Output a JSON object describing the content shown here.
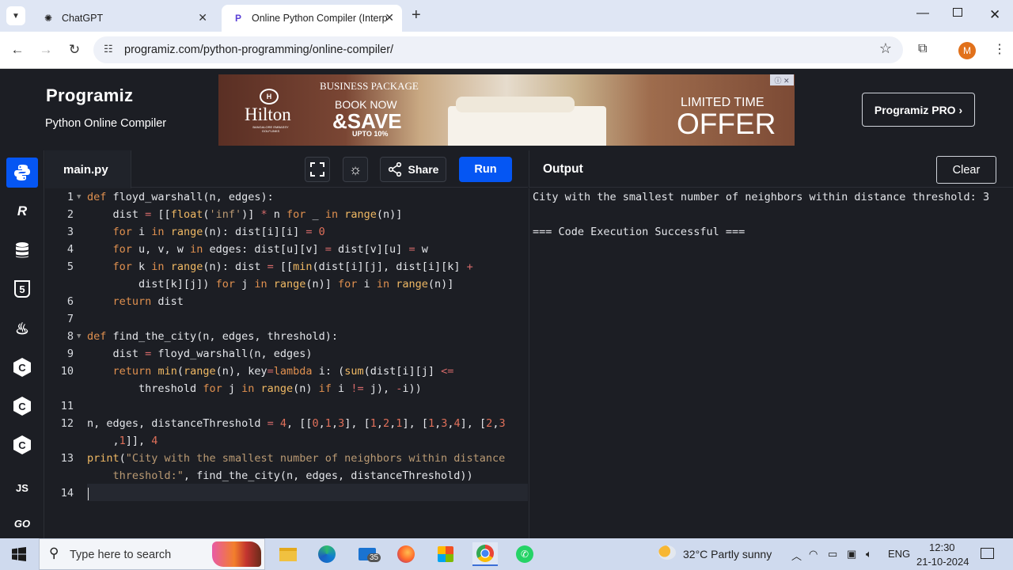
{
  "browser": {
    "tabs": [
      {
        "title": "ChatGPT",
        "active": false
      },
      {
        "title": "Online Python Compiler (Interp",
        "active": true
      }
    ],
    "url": "programiz.com/python-programming/online-compiler/",
    "profile_initial": "M"
  },
  "site": {
    "logo": "Programiz",
    "subtitle": "Python Online Compiler",
    "pro_button": "Programiz PRO ›",
    "ad": {
      "brand": "Hilton",
      "brand_sub": "BANGALORE EMBASSY GOLFLINKS",
      "headline": "BUSINESS PACKAGE",
      "cta1": "BOOK NOW",
      "cta2": "&SAVE",
      "cta3": "UPTO 10%",
      "offer1": "LIMITED TIME",
      "offer2": "OFFER"
    }
  },
  "sidebar": {
    "items": [
      {
        "name": "python",
        "label": "",
        "active": true
      },
      {
        "name": "r",
        "label": "R"
      },
      {
        "name": "sql",
        "label": ""
      },
      {
        "name": "html",
        "label": "5"
      },
      {
        "name": "java",
        "label": ""
      },
      {
        "name": "c",
        "label": "C"
      },
      {
        "name": "cpp",
        "label": "C"
      },
      {
        "name": "csharp",
        "label": "C"
      },
      {
        "name": "js",
        "label": "JS"
      },
      {
        "name": "go",
        "label": "GO"
      }
    ]
  },
  "editor": {
    "filename": "main.py",
    "share_label": "Share",
    "run_label": "Run",
    "line_numbers": [
      "1",
      "2",
      "3",
      "4",
      "5",
      "6",
      "7",
      "8",
      "9",
      "10",
      "11",
      "12",
      "13",
      "14"
    ]
  },
  "output": {
    "title": "Output",
    "clear_label": "Clear",
    "lines": [
      "City with the smallest number of neighbors within distance threshold: 3",
      "",
      "=== Code Execution Successful ==="
    ]
  },
  "taskbar": {
    "search_placeholder": "Type here to search",
    "mail_badge": "35",
    "weather": "32°C  Partly sunny",
    "language": "ENG",
    "time": "12:30",
    "date": "21-10-2024"
  }
}
